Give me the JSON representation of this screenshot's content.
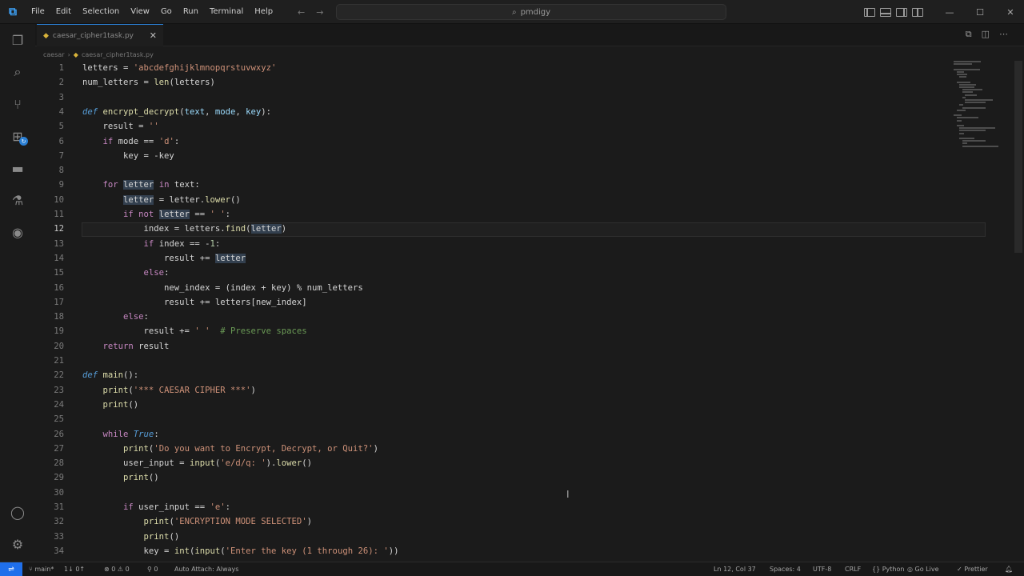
{
  "titlebar": {
    "menu": [
      "File",
      "Edit",
      "Selection",
      "View",
      "Go",
      "Run",
      "Terminal",
      "Help"
    ],
    "search_text": "pmdigy"
  },
  "tab": {
    "label": "caesar_cipher1task.py"
  },
  "breadcrumb": {
    "folder": "caesar",
    "file": "caesar_cipher1task.py"
  },
  "editor": {
    "current_line": 12,
    "lines": [
      {
        "n": "1",
        "t": [
          [
            "letters = ",
            "p"
          ],
          [
            "'abcdefghijklmnopqrstuvwxyz'",
            "st"
          ]
        ]
      },
      {
        "n": "2",
        "t": [
          [
            "num_letters = ",
            "p"
          ],
          [
            "len",
            "fn"
          ],
          [
            "(letters)",
            "p"
          ]
        ]
      },
      {
        "n": "3",
        "t": []
      },
      {
        "n": "4",
        "t": [
          [
            "def ",
            "kd"
          ],
          [
            "encrypt_decrypt",
            "fn"
          ],
          [
            "(",
            "p"
          ],
          [
            "text",
            "vr"
          ],
          [
            ", ",
            "p"
          ],
          [
            "mode",
            "vr"
          ],
          [
            ", ",
            "p"
          ],
          [
            "key",
            "vr"
          ],
          [
            "):",
            "p"
          ]
        ]
      },
      {
        "n": "5",
        "t": [
          [
            "    result = ",
            "p"
          ],
          [
            "''",
            "st"
          ]
        ]
      },
      {
        "n": "6",
        "t": [
          [
            "    ",
            "p"
          ],
          [
            "if ",
            "kw"
          ],
          [
            "mode == ",
            "p"
          ],
          [
            "'d'",
            "st"
          ],
          [
            ":",
            "p"
          ]
        ]
      },
      {
        "n": "7",
        "t": [
          [
            "        key = -key",
            "p"
          ]
        ]
      },
      {
        "n": "8",
        "t": []
      },
      {
        "n": "9",
        "t": [
          [
            "    ",
            "p"
          ],
          [
            "for ",
            "kw"
          ],
          [
            "letter",
            "hl"
          ],
          [
            " in ",
            "kw"
          ],
          [
            "text:",
            "p"
          ]
        ]
      },
      {
        "n": "10",
        "t": [
          [
            "        ",
            "p"
          ],
          [
            "letter",
            "hl"
          ],
          [
            " = letter.",
            "p"
          ],
          [
            "lower",
            "fn"
          ],
          [
            "()",
            "p"
          ]
        ]
      },
      {
        "n": "11",
        "t": [
          [
            "        ",
            "p"
          ],
          [
            "if not ",
            "kw"
          ],
          [
            "letter",
            "hl"
          ],
          [
            " == ",
            "p"
          ],
          [
            "' '",
            "st"
          ],
          [
            ":",
            "p"
          ]
        ]
      },
      {
        "n": "12",
        "t": [
          [
            "            index = letters.",
            "p"
          ],
          [
            "find",
            "fn"
          ],
          [
            "(",
            "p"
          ],
          [
            "letter",
            "hl"
          ],
          [
            ")",
            "p"
          ]
        ]
      },
      {
        "n": "13",
        "t": [
          [
            "            ",
            "p"
          ],
          [
            "if ",
            "kw"
          ],
          [
            "index == -",
            "p"
          ],
          [
            "1",
            "nm"
          ],
          [
            ":",
            "p"
          ]
        ]
      },
      {
        "n": "14",
        "t": [
          [
            "                result += ",
            "p"
          ],
          [
            "letter",
            "hl"
          ]
        ]
      },
      {
        "n": "15",
        "t": [
          [
            "            ",
            "p"
          ],
          [
            "else",
            "kw"
          ],
          [
            ":",
            "p"
          ]
        ]
      },
      {
        "n": "16",
        "t": [
          [
            "                new_index = (index + key) % num_letters",
            "p"
          ]
        ]
      },
      {
        "n": "17",
        "t": [
          [
            "                result += letters[new_index]",
            "p"
          ]
        ]
      },
      {
        "n": "18",
        "t": [
          [
            "        ",
            "p"
          ],
          [
            "else",
            "kw"
          ],
          [
            ":",
            "p"
          ]
        ]
      },
      {
        "n": "19",
        "t": [
          [
            "            result += ",
            "p"
          ],
          [
            "' '",
            "st"
          ],
          [
            "  ",
            "p"
          ],
          [
            "# Preserve spaces",
            "cm"
          ]
        ]
      },
      {
        "n": "20",
        "t": [
          [
            "    ",
            "p"
          ],
          [
            "return ",
            "kw"
          ],
          [
            "result",
            "p"
          ]
        ]
      },
      {
        "n": "21",
        "t": []
      },
      {
        "n": "22",
        "t": [
          [
            "def ",
            "kd"
          ],
          [
            "main",
            "fn"
          ],
          [
            "():",
            "p"
          ]
        ]
      },
      {
        "n": "23",
        "t": [
          [
            "    ",
            "p"
          ],
          [
            "print",
            "fn"
          ],
          [
            "(",
            "p"
          ],
          [
            "'*** CAESAR CIPHER ***'",
            "st"
          ],
          [
            ")",
            "p"
          ]
        ]
      },
      {
        "n": "24",
        "t": [
          [
            "    ",
            "p"
          ],
          [
            "print",
            "fn"
          ],
          [
            "()",
            "p"
          ]
        ]
      },
      {
        "n": "25",
        "t": []
      },
      {
        "n": "26",
        "t": [
          [
            "    ",
            "p"
          ],
          [
            "while ",
            "kw"
          ],
          [
            "True",
            "kd"
          ],
          [
            ":",
            "p"
          ]
        ]
      },
      {
        "n": "27",
        "t": [
          [
            "        ",
            "p"
          ],
          [
            "print",
            "fn"
          ],
          [
            "(",
            "p"
          ],
          [
            "'Do you want to Encrypt, Decrypt, or Quit?'",
            "st"
          ],
          [
            ")",
            "p"
          ]
        ]
      },
      {
        "n": "28",
        "t": [
          [
            "        user_input = ",
            "p"
          ],
          [
            "input",
            "fn"
          ],
          [
            "(",
            "p"
          ],
          [
            "'e/d/q: '",
            "st"
          ],
          [
            ").",
            "p"
          ],
          [
            "lower",
            "fn"
          ],
          [
            "()",
            "p"
          ]
        ]
      },
      {
        "n": "29",
        "t": [
          [
            "        ",
            "p"
          ],
          [
            "print",
            "fn"
          ],
          [
            "()",
            "p"
          ]
        ]
      },
      {
        "n": "30",
        "t": []
      },
      {
        "n": "31",
        "t": [
          [
            "        ",
            "p"
          ],
          [
            "if ",
            "kw"
          ],
          [
            "user_input == ",
            "p"
          ],
          [
            "'e'",
            "st"
          ],
          [
            ":",
            "p"
          ]
        ]
      },
      {
        "n": "32",
        "t": [
          [
            "            ",
            "p"
          ],
          [
            "print",
            "fn"
          ],
          [
            "(",
            "p"
          ],
          [
            "'ENCRYPTION MODE SELECTED'",
            "st"
          ],
          [
            ")",
            "p"
          ]
        ]
      },
      {
        "n": "33",
        "t": [
          [
            "            ",
            "p"
          ],
          [
            "print",
            "fn"
          ],
          [
            "()",
            "p"
          ]
        ]
      },
      {
        "n": "34",
        "t": [
          [
            "            key = ",
            "p"
          ],
          [
            "int",
            "fn"
          ],
          [
            "(",
            "p"
          ],
          [
            "input",
            "fn"
          ],
          [
            "(",
            "p"
          ],
          [
            "'Enter the key (1 through 26): '",
            "st"
          ],
          [
            "))",
            "p"
          ]
        ]
      }
    ]
  },
  "statusbar": {
    "branch": "main*",
    "sync": "1↓ 0↑",
    "problems": "⊗ 0 ⚠ 0",
    "ports": "0",
    "auto_attach": "Auto Attach: Always",
    "position": "Ln 12, Col 37",
    "spaces": "Spaces: 4",
    "encoding": "UTF-8",
    "eol": "CRLF",
    "language": "Python",
    "golive": "Go Live",
    "prettier": "Prettier"
  },
  "colors": {
    "accent": "#2a7fd4",
    "background": "#1b1b1b",
    "keyword": "#c586c0",
    "function": "#dcdcaa",
    "string": "#ce9178"
  }
}
